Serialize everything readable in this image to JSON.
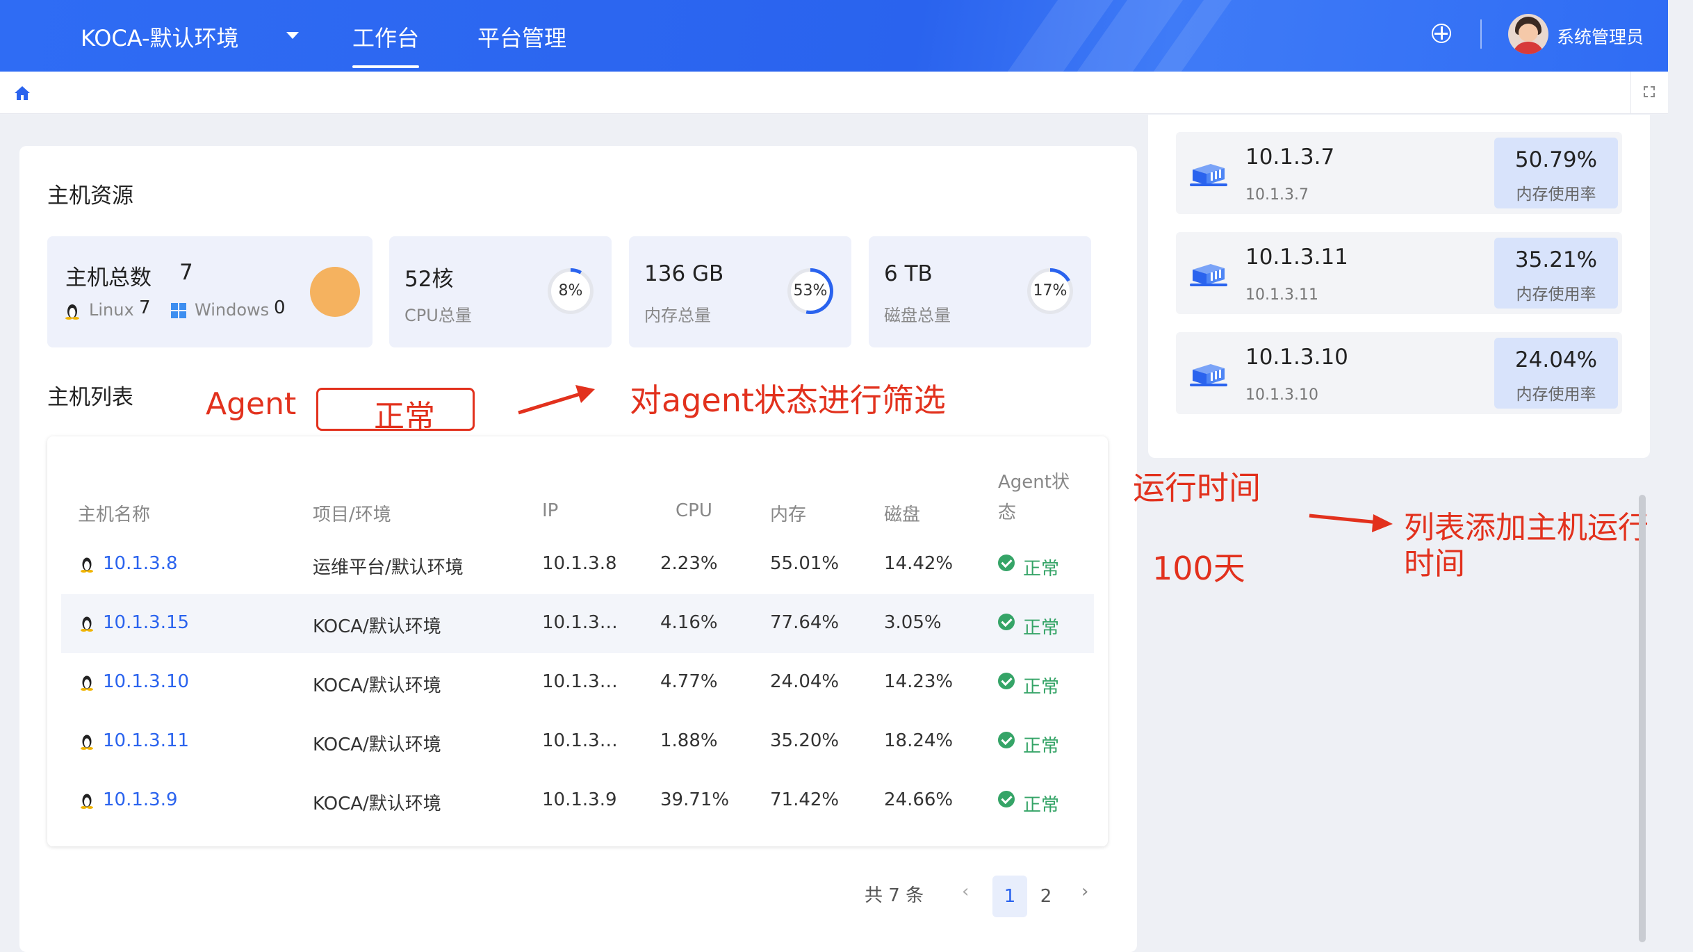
{
  "header": {
    "env_label": "KOCA-默认环境",
    "nav": [
      "工作台",
      "平台管理"
    ],
    "user_name": "系统管理员"
  },
  "host_resources": {
    "title": "主机资源",
    "total_label": "主机总数",
    "total_value": "7",
    "linux_label": "Linux",
    "linux_count": "7",
    "windows_label": "Windows",
    "windows_count": "0",
    "cpu": {
      "value": "52核",
      "label": "CPU总量",
      "pct": "8%",
      "ratio": 0.08
    },
    "memory": {
      "value": "136 GB",
      "label": "内存总量",
      "pct": "53%",
      "ratio": 0.53
    },
    "disk": {
      "value": "6 TB",
      "label": "磁盘总量",
      "pct": "17%",
      "ratio": 0.17
    }
  },
  "host_list": {
    "title": "主机列表",
    "columns": [
      "主机名称",
      "项目/环境",
      "IP",
      "CPU",
      "内存",
      "磁盘",
      "Agent状",
      "态"
    ],
    "rows": [
      {
        "name": "10.1.3.8",
        "project": "运维平台/默认环境",
        "ip": "10.1.3.8",
        "cpu": "2.23%",
        "mem": "55.01%",
        "disk": "14.42%",
        "status": "正常"
      },
      {
        "name": "10.1.3.15",
        "project": "KOCA/默认环境",
        "ip": "10.1.3…",
        "cpu": "4.16%",
        "mem": "77.64%",
        "disk": "3.05%",
        "status": "正常"
      },
      {
        "name": "10.1.3.10",
        "project": "KOCA/默认环境",
        "ip": "10.1.3…",
        "cpu": "4.77%",
        "mem": "24.04%",
        "disk": "14.23%",
        "status": "正常"
      },
      {
        "name": "10.1.3.11",
        "project": "KOCA/默认环境",
        "ip": "10.1.3…",
        "cpu": "1.88%",
        "mem": "35.20%",
        "disk": "18.24%",
        "status": "正常"
      },
      {
        "name": "10.1.3.9",
        "project": "KOCA/默认环境",
        "ip": "10.1.3.9",
        "cpu": "39.71%",
        "mem": "71.42%",
        "disk": "24.66%",
        "status": "正常"
      }
    ],
    "pagination": {
      "total": "共 7 条",
      "pages": [
        "1",
        "2"
      ],
      "current": "1"
    }
  },
  "memory_top": [
    {
      "ip": "10.1.3.7",
      "sub": "10.1.3.7",
      "value": "50.79%",
      "label": "内存使用率"
    },
    {
      "ip": "10.1.3.11",
      "sub": "10.1.3.11",
      "value": "35.21%",
      "label": "内存使用率"
    },
    {
      "ip": "10.1.3.10",
      "sub": "10.1.3.10",
      "value": "24.04%",
      "label": "内存使用率"
    }
  ],
  "annotations": {
    "agent": "Agent",
    "agent_box": "正常",
    "filter_note": "对agent状态进行筛选",
    "runtime_title": "运行时间",
    "runtime_value": "100天",
    "runtime_note_1": "列表添加主机运行",
    "runtime_note_2": "时间"
  },
  "colors": {
    "primary": "#2f6cf4",
    "success": "#35a467",
    "annotation": "#e2311d",
    "orange": "#f5b25f"
  }
}
